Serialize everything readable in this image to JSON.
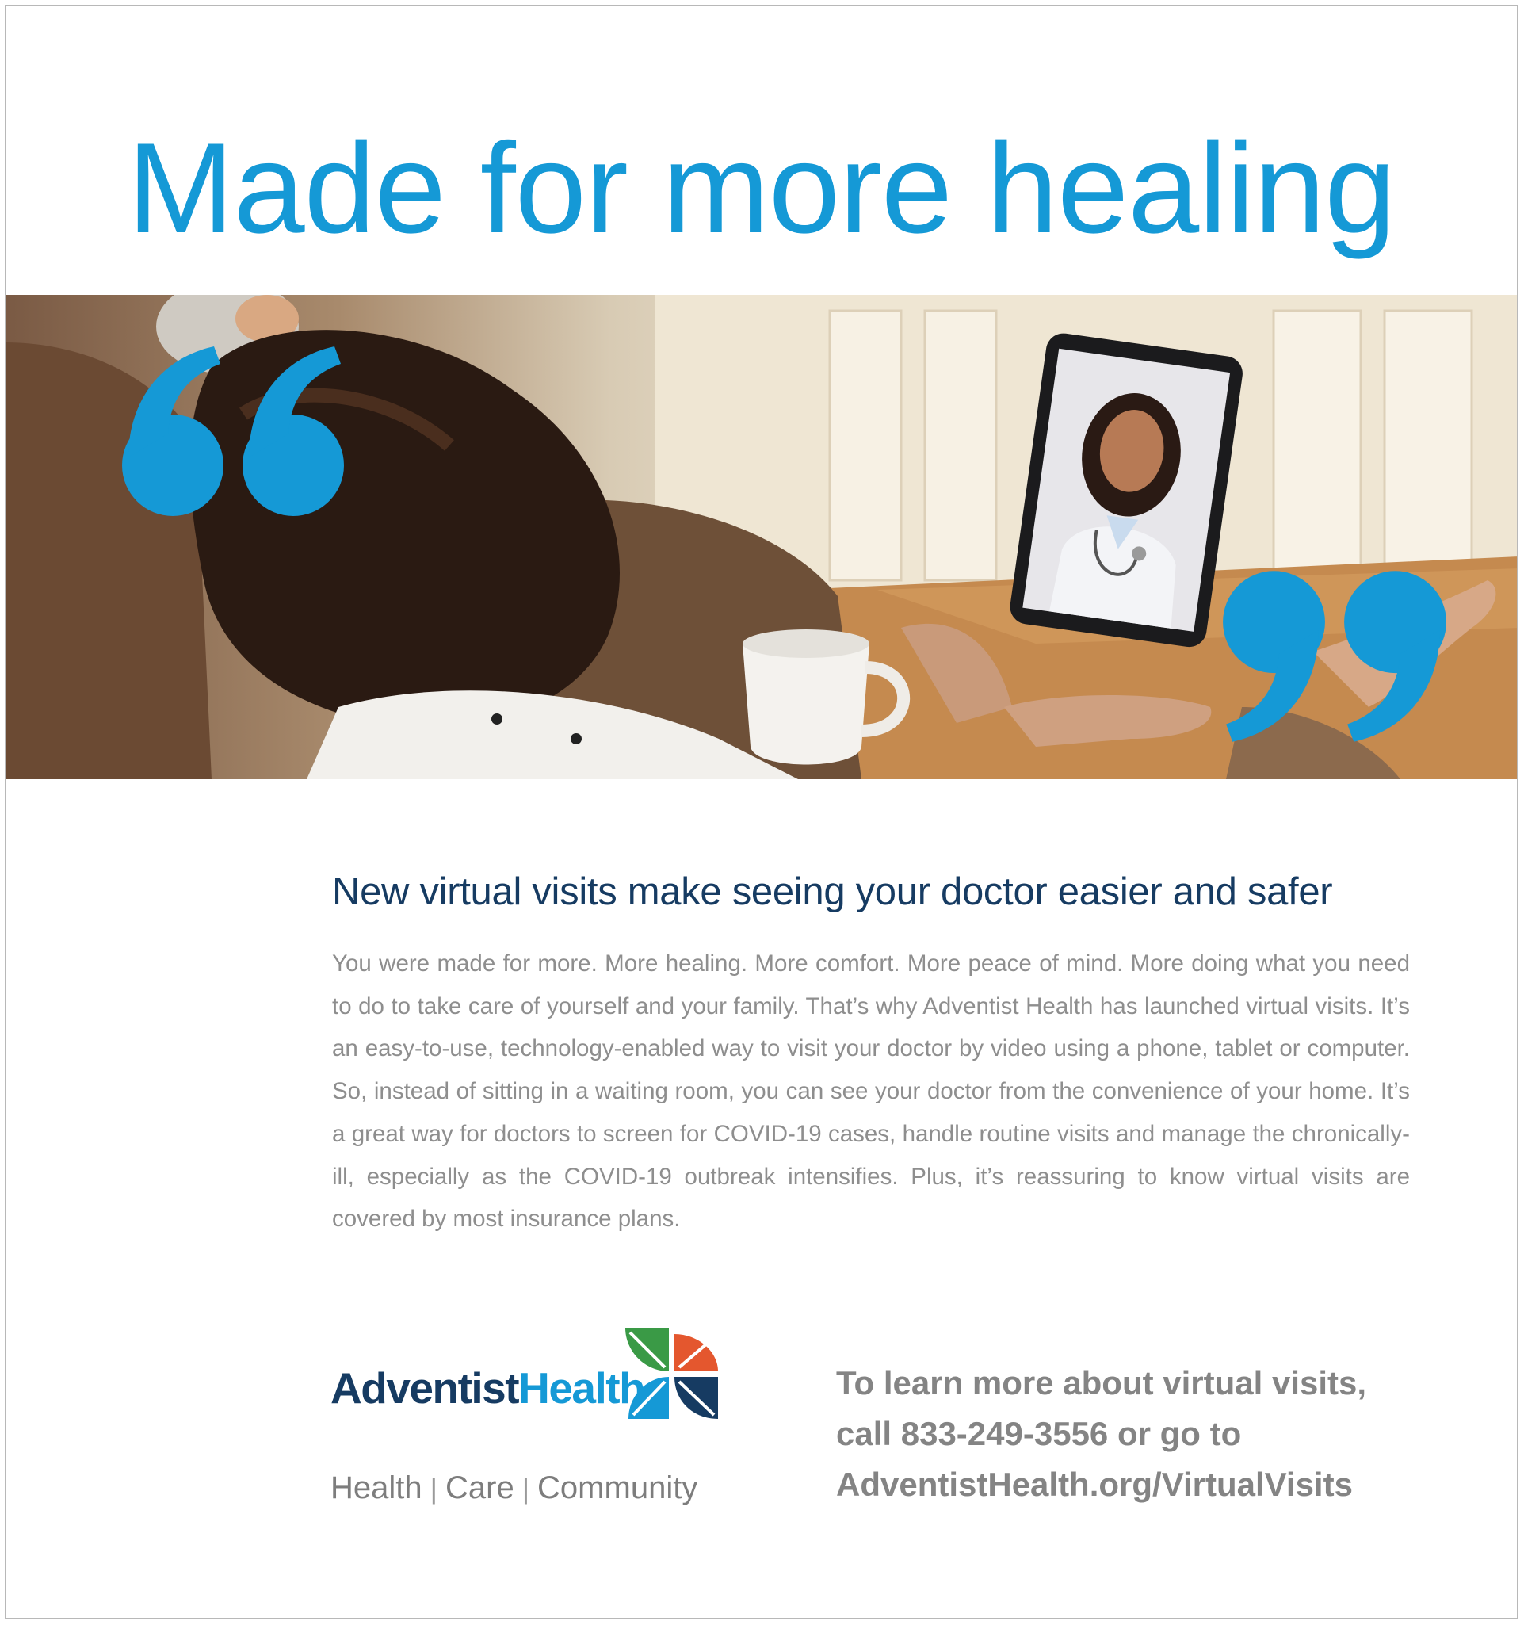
{
  "headline": "Made for more healing",
  "photo": {
    "alt_icon": "telehealth-video-call-photo"
  },
  "subhead": "New virtual visits make seeing your doctor easier and safer",
  "body": "You were made for more. More healing. More comfort. More peace of mind. More doing what you need to do to take care of yourself and your family. That’s why Adventist Health has launched virtual visits. It’s an easy-to-use, technology-enabled way to visit your doctor by video using a phone, tablet or computer. So, instead of sitting in a waiting room, you can see your doctor from the convenience of your home. It’s a great way for doctors to screen for COVID-19 cases, handle routine visits and manage the chronically-ill, especially as the COVID-19 outbreak intensifies. Plus, it’s reassuring to know virtual visits are covered by most insurance plans.",
  "logo": {
    "part1": "Adventist",
    "part2": "Health",
    "colors": {
      "navy": "#163b62",
      "blue": "#1599d6",
      "green": "#3a9a46",
      "orange": "#e4572e"
    }
  },
  "tagline": {
    "items": [
      "Health",
      "Care",
      "Community"
    ],
    "separator": "|"
  },
  "cta": {
    "line1": "To learn more about virtual visits,",
    "line2": "call 833-249-3556 or go to",
    "line3": "AdventistHealth.org/VirtualVisits"
  },
  "colors": {
    "headline": "#1599d6",
    "subhead": "#163b62",
    "body": "#8e8e8e",
    "cta": "#848484"
  }
}
